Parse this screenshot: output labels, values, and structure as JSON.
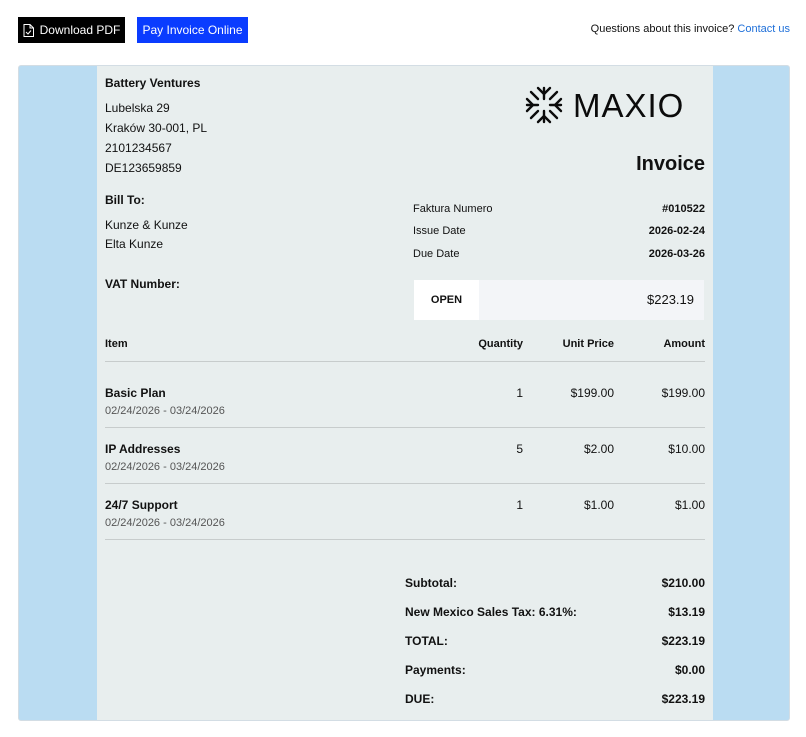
{
  "toolbar": {
    "download_label": "Download PDF",
    "pay_label": "Pay Invoice Online",
    "questions_text": "Questions about this invoice?",
    "contact_label": "Contact us"
  },
  "seller": {
    "name": "Battery Ventures",
    "lines": [
      "Lubelska 29",
      "Kraków 30-001, PL",
      "2101234567",
      "DE123659859"
    ]
  },
  "logo": {
    "text": "MAXIO"
  },
  "invoice": {
    "title": "Invoice",
    "meta": [
      {
        "label": "Faktura Numero",
        "value": "#010522"
      },
      {
        "label": "Issue Date",
        "value": "2026-02-24"
      },
      {
        "label": "Due Date",
        "value": "2026-03-26"
      }
    ],
    "status": "OPEN",
    "status_amount": "$223.19"
  },
  "bill_to": {
    "label": "Bill To:",
    "lines": [
      "Kunze & Kunze",
      "Elta Kunze"
    ]
  },
  "vat": {
    "label": "VAT Number:"
  },
  "table": {
    "headers": {
      "item": "Item",
      "quantity": "Quantity",
      "unit_price": "Unit Price",
      "amount": "Amount"
    },
    "rows": [
      {
        "name": "Basic Plan",
        "period": "02/24/2026 - 03/24/2026",
        "quantity": "1",
        "unit_price": "$199.00",
        "amount": "$199.00"
      },
      {
        "name": "IP Addresses",
        "period": "02/24/2026 - 03/24/2026",
        "quantity": "5",
        "unit_price": "$2.00",
        "amount": "$10.00"
      },
      {
        "name": "24/7 Support",
        "period": "02/24/2026 - 03/24/2026",
        "quantity": "1",
        "unit_price": "$1.00",
        "amount": "$1.00"
      }
    ]
  },
  "totals": [
    {
      "label": "Subtotal:",
      "value": "$210.00"
    },
    {
      "label": "New Mexico Sales Tax: 6.31%:",
      "value": "$13.19"
    },
    {
      "label": "TOTAL:",
      "value": "$223.19"
    },
    {
      "label": "Payments:",
      "value": "$0.00"
    },
    {
      "label": "DUE:",
      "value": "$223.19"
    }
  ],
  "colors": {
    "pay_button": "#0a3cff",
    "download_button": "#000000",
    "link": "#1e6fd9",
    "frame": "#badcf2",
    "paper": "#e8eeee"
  }
}
